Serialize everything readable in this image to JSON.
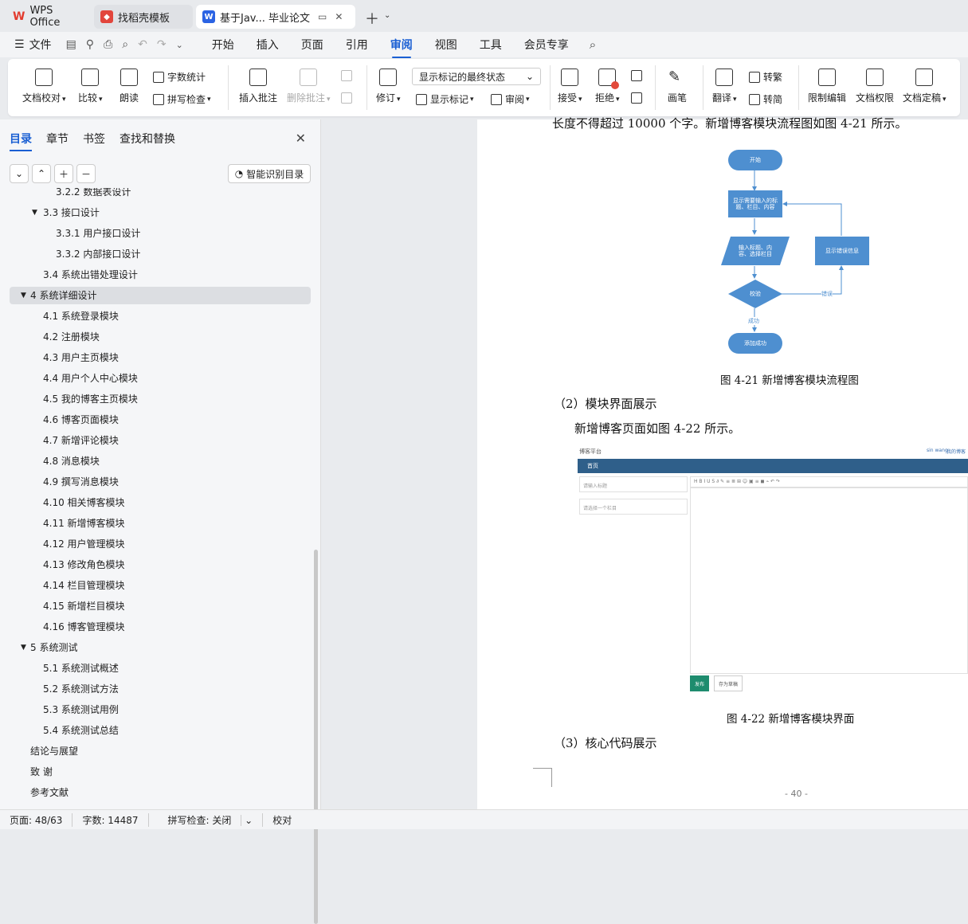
{
  "tabs": [
    {
      "label": "WPS Office",
      "icon": "wps-logo-icon"
    },
    {
      "label": "找稻壳模板",
      "icon": "docer-icon"
    },
    {
      "label": "基于Jav... 毕业论文",
      "icon": "word-doc-icon"
    }
  ],
  "menu": {
    "file": "文件",
    "items": [
      "开始",
      "插入",
      "页面",
      "引用",
      "审阅",
      "视图",
      "工具",
      "会员专享"
    ],
    "active": "审阅"
  },
  "ribbon": {
    "doc_proof": "文档校对",
    "compare": "比较",
    "read_aloud": "朗读",
    "word_count": "字数统计",
    "spell_check": "拼写检查",
    "insert_comment": "插入批注",
    "delete_comment": "删除批注",
    "track": "修订",
    "markup_state": "显示标记的最终状态",
    "show_markup": "显示标记",
    "review": "审阅",
    "accept": "接受",
    "reject": "拒绝",
    "pen": "画笔",
    "translate": "翻译",
    "to_traditional": "转繁",
    "to_simplified": "转简",
    "restrict": "限制编辑",
    "permission": "文档权限",
    "finalize": "文档定稿"
  },
  "sidebar": {
    "tabs": [
      "目录",
      "章节",
      "书签",
      "查找和替换"
    ],
    "smart_toc": "智能识别目录",
    "toc": [
      {
        "label": "3.2.2  数据表设计",
        "level": 3
      },
      {
        "label": "3.3  接口设计",
        "level": 2,
        "toggle": "▼"
      },
      {
        "label": "3.3.1  用户接口设计",
        "level": 3
      },
      {
        "label": "3.3.2  内部接口设计",
        "level": 3
      },
      {
        "label": "3.4  系统出错处理设计",
        "level": 2
      },
      {
        "label": "4  系统详细设计",
        "level": 1,
        "toggle": "▼"
      },
      {
        "label": "4.1  系统登录模块",
        "level": 2
      },
      {
        "label": "4.2  注册模块",
        "level": 2
      },
      {
        "label": "4.3  用户主页模块",
        "level": 2
      },
      {
        "label": "4.4  用户个人中心模块",
        "level": 2
      },
      {
        "label": "4.5  我的博客主页模块",
        "level": 2
      },
      {
        "label": "4.6  博客页面模块",
        "level": 2
      },
      {
        "label": "4.7  新增评论模块",
        "level": 2
      },
      {
        "label": "4.8  消息模块",
        "level": 2
      },
      {
        "label": "4.9  撰写消息模块",
        "level": 2
      },
      {
        "label": "4.10  相关博客模块",
        "level": 2
      },
      {
        "label": "4.11  新增博客模块",
        "level": 2
      },
      {
        "label": "4.12  用户管理模块",
        "level": 2
      },
      {
        "label": "4.13  修改角色模块",
        "level": 2
      },
      {
        "label": "4.14  栏目管理模块",
        "level": 2
      },
      {
        "label": "4.15  新增栏目模块",
        "level": 2
      },
      {
        "label": "4.16  博客管理模块",
        "level": 2
      },
      {
        "label": "5  系统测试",
        "level": 1,
        "toggle": "▼"
      },
      {
        "label": "5.1  系统测试概述",
        "level": 2
      },
      {
        "label": "5.2  系统测试方法",
        "level": 2
      },
      {
        "label": "5.3  系统测试用例",
        "level": 2
      },
      {
        "label": "5.4  系统测试总结",
        "level": 2
      },
      {
        "label": "结论与展望",
        "level": 1
      },
      {
        "label": "致    谢",
        "level": 1
      },
      {
        "label": "参考文献",
        "level": 1
      }
    ]
  },
  "document": {
    "top_line": "长度不得超过 10000 个字。新增博客模块流程图如图 4-21 所示。",
    "flow": {
      "start": "开始",
      "input_prompt": "显示需要输入的标题、栏目、内容",
      "input": "输入标题、内容、选择栏目",
      "error_box": "显示错误信息",
      "check": "校验",
      "error_label": "错误",
      "success_label": "成功",
      "done": "添加成功"
    },
    "caption1": "图  4-21  新增博客模块流程图",
    "section2": "（2）模块界面展示",
    "para2": "新增博客页面如图 4-22 所示。",
    "shot": {
      "brand": "博客平台",
      "user": "sin wang",
      "my_blog": "我的博客",
      "nav": "首页",
      "title_ph": "请输入标题",
      "column_ph": "请选择一个栏目",
      "toolbar": "H  B  I  U  S  ∂  ✎  ≡  ≣  ⊞  ☺  ▣  ≡  ◼  ⌁  ↶  ↷",
      "publish": "发布",
      "draft": "存为草稿"
    },
    "caption2": "图  4-22  新增博客模块界面",
    "section3": "（3）核心代码展示",
    "page_num": "- 40 -"
  },
  "status": {
    "page": "页面: 48/63",
    "words": "字数: 14487",
    "spell": "拼写检查: 关闭",
    "proof": "校对"
  },
  "colors": {
    "accent": "#1a5fd3",
    "flow_blue": "#4e8fd0",
    "shot_nav": "#2f5f8a",
    "shot_green": "#1e8c6e"
  }
}
